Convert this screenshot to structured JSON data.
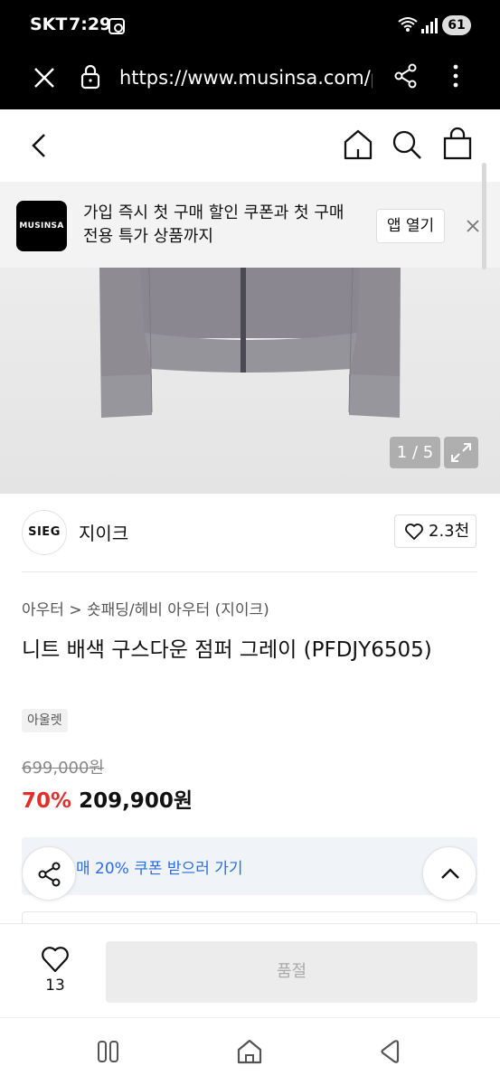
{
  "status_bar": {
    "carrier": "SKT",
    "time": "7:29",
    "battery": "61"
  },
  "browser": {
    "url": "https://www.musinsa.com/p"
  },
  "app_banner": {
    "logo_text": "MUSINSA",
    "message": "가입 즉시 첫 구매 할인 쿠폰과 첫 구매 전용 특가 상품까지",
    "open_app_label": "앱 열기"
  },
  "product_image": {
    "counter": "1 / 5"
  },
  "brand": {
    "logo_text": "SIEG",
    "name": "지이크",
    "like_count": "2.3천"
  },
  "breadcrumb": "아우터 > 숏패딩/헤비 아우터 (지이크)",
  "product": {
    "title": "니트 배색 구스다운 점퍼 그레이 (PFDJY6505)",
    "tag": "아울렛",
    "original_price": "699,000원",
    "discount": "70%",
    "price": "209,900원"
  },
  "coupon": {
    "text": "매 20% 쿠폰 받으러 가기"
  },
  "action_bar": {
    "like_count": "13",
    "soldout_label": "품절"
  },
  "colors": {
    "discount_red": "#e0302c",
    "coupon_blue": "#2a6ee0",
    "coupon_bg": "#f0f3f8"
  }
}
